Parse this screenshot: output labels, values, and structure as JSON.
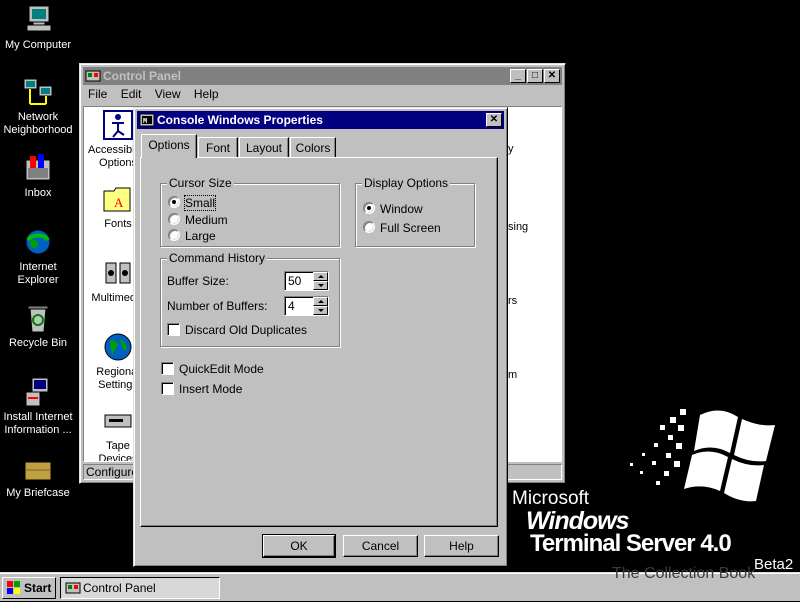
{
  "desktop": {
    "icons": [
      {
        "label": "My Computer",
        "icon": "my-computer-icon"
      },
      {
        "label": "Network Neighborhood",
        "icon": "network-neighborhood-icon"
      },
      {
        "label": "Inbox",
        "icon": "inbox-icon"
      },
      {
        "label": "Internet Explorer",
        "icon": "internet-explorer-icon"
      },
      {
        "label": "Recycle Bin",
        "icon": "recycle-bin-icon"
      },
      {
        "label": "Install Internet Information ...",
        "icon": "install-iis-icon"
      },
      {
        "label": "My Briefcase",
        "icon": "briefcase-icon"
      }
    ],
    "branding": {
      "microsoft": "Microsoft",
      "product": "Windows",
      "product2": "Terminal Server 4.0",
      "edition": "Beta2",
      "watermark": "The Collection Book"
    }
  },
  "control_panel": {
    "title": "Control Panel",
    "menu": [
      "File",
      "Edit",
      "View",
      "Help"
    ],
    "items": [
      {
        "label": "Accessibility Options"
      },
      {
        "label": "Fonts"
      },
      {
        "label": "Multimedia"
      },
      {
        "label": "Regional Settings"
      },
      {
        "label": "Tape Devices"
      }
    ],
    "right_fragments": [
      "y",
      "sing",
      "rs",
      "m"
    ],
    "status": "Configures"
  },
  "dialog": {
    "title": "Console Windows Properties",
    "tabs": [
      "Options",
      "Font",
      "Layout",
      "Colors"
    ],
    "selected_tab": "Options",
    "cursor_size": {
      "legend": "Cursor Size",
      "options": [
        "Small",
        "Medium",
        "Large"
      ],
      "selected": "Small"
    },
    "display_options": {
      "legend": "Display Options",
      "options": [
        "Window",
        "Full Screen"
      ],
      "selected": "Window"
    },
    "command_history": {
      "legend": "Command History",
      "buffer_size_label": "Buffer Size:",
      "buffer_size": "50",
      "num_buffers_label": "Number of Buffers:",
      "num_buffers": "4",
      "discard_label": "Discard Old Duplicates",
      "discard_checked": false
    },
    "quickedit_label": "QuickEdit Mode",
    "quickedit_checked": false,
    "insert_label": "Insert Mode",
    "insert_checked": false,
    "buttons": {
      "ok": "OK",
      "cancel": "Cancel",
      "help": "Help"
    }
  },
  "taskbar": {
    "start": "Start",
    "tasks": [
      {
        "label": "Control Panel"
      }
    ]
  }
}
